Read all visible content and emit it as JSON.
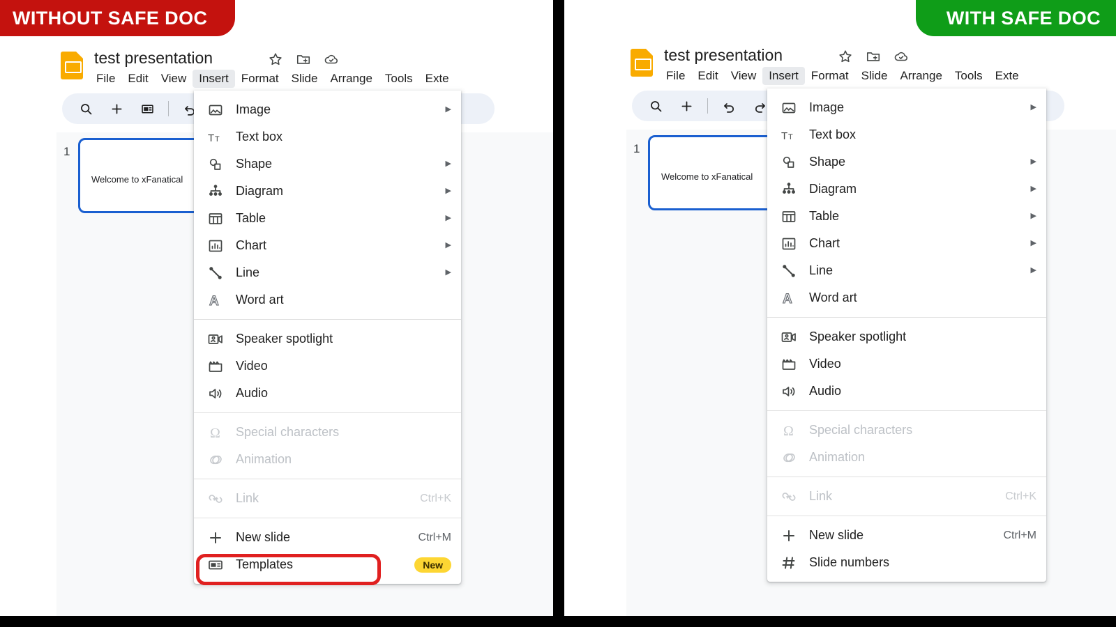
{
  "banners": {
    "left": {
      "label": "WITHOUT SAFE DOC",
      "color": "#C4120E"
    },
    "right": {
      "label": "WITH SAFE DOC",
      "color": "#0F9D18"
    }
  },
  "app": {
    "doc_title": "test presentation",
    "title_icons": [
      "star-icon",
      "move-to-folder-icon",
      "cloud-saved-icon"
    ],
    "menubar": [
      {
        "label": "File",
        "active": false
      },
      {
        "label": "Edit",
        "active": false
      },
      {
        "label": "View",
        "active": false
      },
      {
        "label": "Insert",
        "active": true
      },
      {
        "label": "Format",
        "active": false
      },
      {
        "label": "Slide",
        "active": false
      },
      {
        "label": "Arrange",
        "active": false
      },
      {
        "label": "Tools",
        "active": false
      },
      {
        "label": "Exte",
        "active": false
      }
    ],
    "toolbar_left": [
      "search-icon",
      "new-slide-icon",
      "layout-icon",
      "separator",
      "undo-icon",
      "redo-icon"
    ],
    "toolbar_right": [
      "search-icon",
      "new-slide-icon",
      "separator",
      "undo-icon",
      "redo-icon",
      "paint-format-icon"
    ],
    "filmstrip": {
      "slide_number": "1",
      "slide_text": "Welcome to xFanatical"
    },
    "selection_color": "#1A5FD0"
  },
  "insert_menu_left": {
    "groups": [
      [
        {
          "icon": "image-icon",
          "label": "Image",
          "submenu": true
        },
        {
          "icon": "textbox-icon",
          "label": "Text box",
          "submenu": false
        },
        {
          "icon": "shape-icon",
          "label": "Shape",
          "submenu": true
        },
        {
          "icon": "diagram-icon",
          "label": "Diagram",
          "submenu": true
        },
        {
          "icon": "table-icon",
          "label": "Table",
          "submenu": true
        },
        {
          "icon": "chart-icon",
          "label": "Chart",
          "submenu": true
        },
        {
          "icon": "line-icon",
          "label": "Line",
          "submenu": true
        },
        {
          "icon": "wordart-icon",
          "label": "Word art",
          "submenu": false
        }
      ],
      [
        {
          "icon": "speaker-spotlight-icon",
          "label": "Speaker spotlight",
          "submenu": false
        },
        {
          "icon": "video-icon",
          "label": "Video",
          "submenu": false
        },
        {
          "icon": "audio-icon",
          "label": "Audio",
          "submenu": false
        }
      ],
      [
        {
          "icon": "omega-icon",
          "label": "Special characters",
          "disabled": true
        },
        {
          "icon": "animation-icon",
          "label": "Animation",
          "disabled": true
        }
      ],
      [
        {
          "icon": "link-icon",
          "label": "Link",
          "accel": "Ctrl+K",
          "disabled": true
        }
      ],
      [
        {
          "icon": "plus-icon",
          "label": "New slide",
          "accel": "Ctrl+M"
        },
        {
          "icon": "templates-icon",
          "label": "Templates",
          "badge": "New",
          "highlighted": true
        }
      ]
    ]
  },
  "insert_menu_right": {
    "groups": [
      [
        {
          "icon": "image-icon",
          "label": "Image",
          "submenu": true
        },
        {
          "icon": "textbox-icon",
          "label": "Text box",
          "submenu": false
        },
        {
          "icon": "shape-icon",
          "label": "Shape",
          "submenu": true
        },
        {
          "icon": "diagram-icon",
          "label": "Diagram",
          "submenu": true
        },
        {
          "icon": "table-icon",
          "label": "Table",
          "submenu": true
        },
        {
          "icon": "chart-icon",
          "label": "Chart",
          "submenu": true
        },
        {
          "icon": "line-icon",
          "label": "Line",
          "submenu": true
        },
        {
          "icon": "wordart-icon",
          "label": "Word art",
          "submenu": false
        }
      ],
      [
        {
          "icon": "speaker-spotlight-icon",
          "label": "Speaker spotlight",
          "submenu": false
        },
        {
          "icon": "video-icon",
          "label": "Video",
          "submenu": false
        },
        {
          "icon": "audio-icon",
          "label": "Audio",
          "submenu": false
        }
      ],
      [
        {
          "icon": "omega-icon",
          "label": "Special characters",
          "disabled": true
        },
        {
          "icon": "animation-icon",
          "label": "Animation",
          "disabled": true
        }
      ],
      [
        {
          "icon": "link-icon",
          "label": "Link",
          "accel": "Ctrl+K",
          "disabled": true
        }
      ],
      [
        {
          "icon": "plus-icon",
          "label": "New slide",
          "accel": "Ctrl+M"
        },
        {
          "icon": "slide-number-icon",
          "label": "Slide numbers"
        }
      ]
    ]
  }
}
